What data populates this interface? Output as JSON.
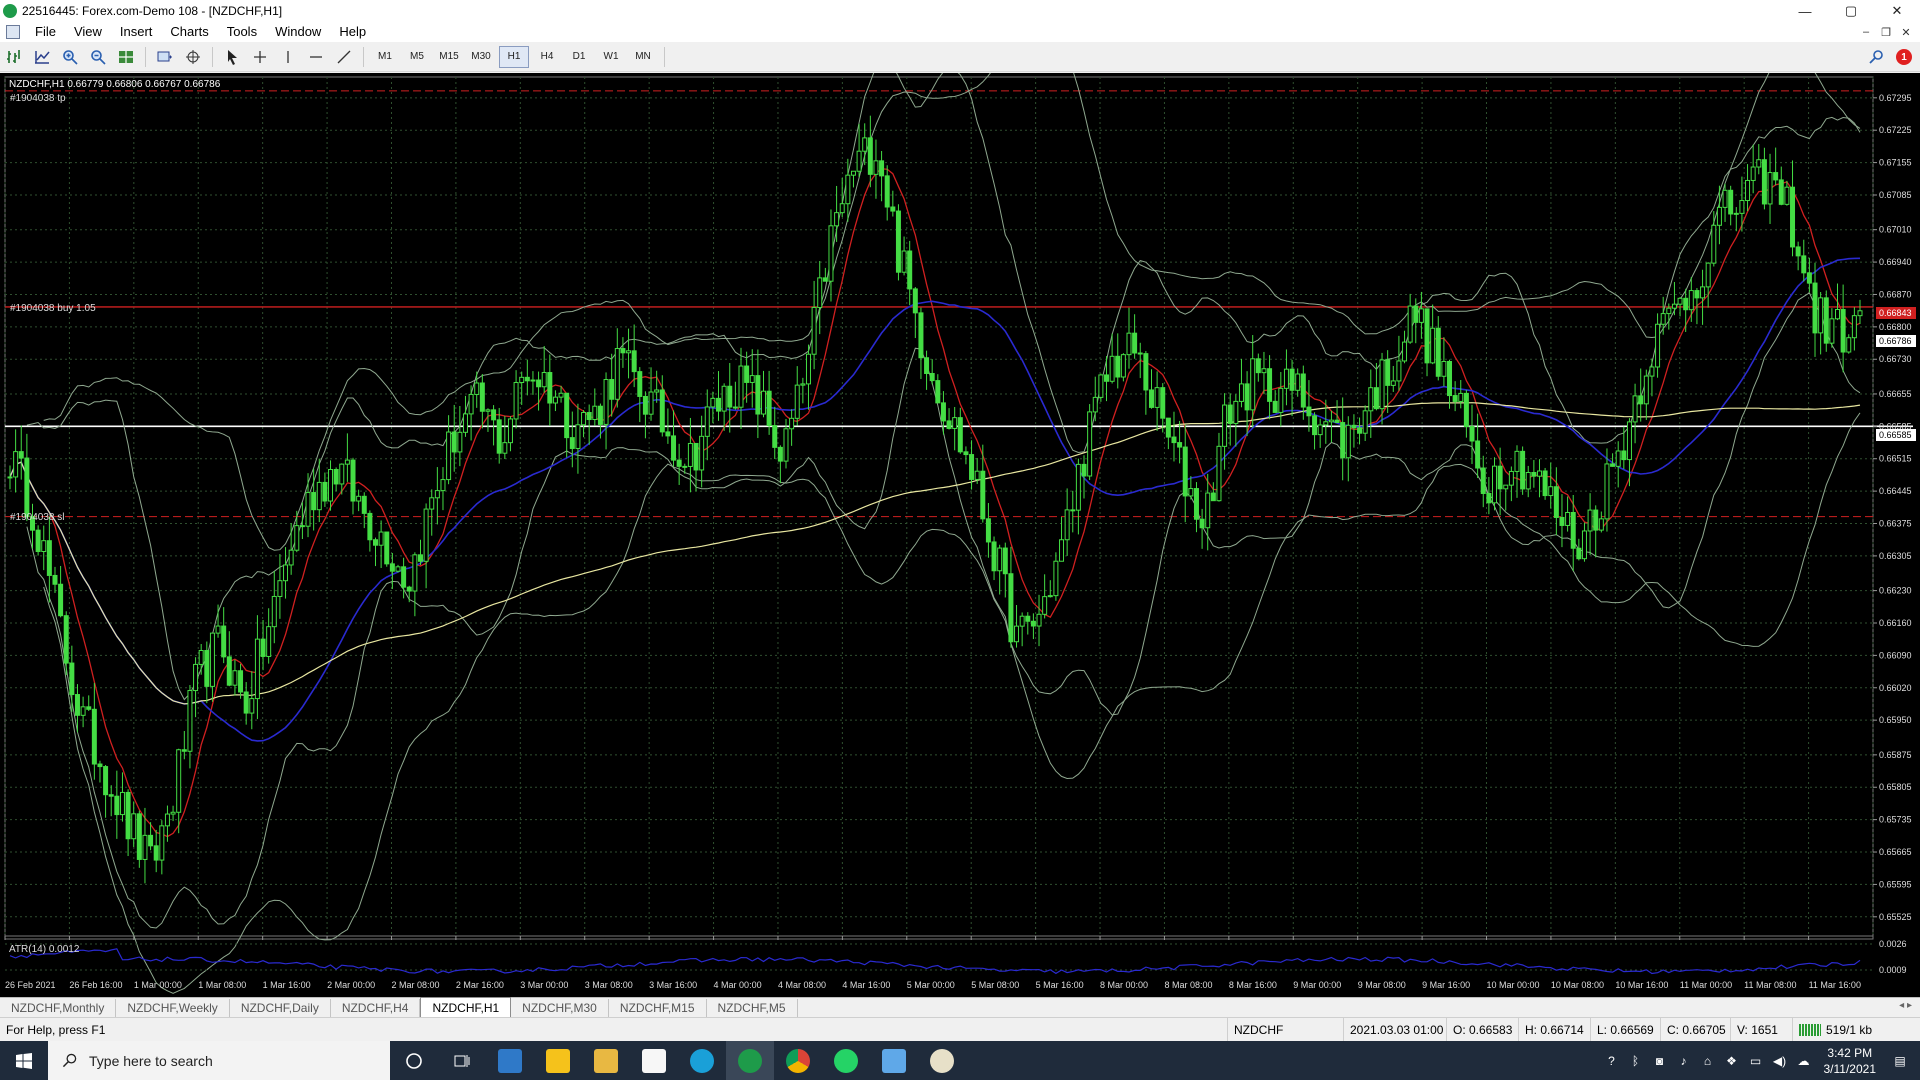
{
  "window": {
    "title": "22516445: Forex.com-Demo 108 - [NZDCHF,H1]",
    "controls": [
      "—",
      "▢",
      "✕"
    ]
  },
  "menu": [
    "File",
    "View",
    "Insert",
    "Charts",
    "Tools",
    "Window",
    "Help"
  ],
  "toolbar": {
    "timeframes": [
      "M1",
      "M5",
      "M15",
      "M30",
      "H1",
      "H4",
      "D1",
      "W1",
      "MN"
    ],
    "active_timeframe": "H1",
    "notification_count": "1"
  },
  "chart": {
    "header": "NZDCHF,H1  0.66779 0.66806 0.66767 0.66786",
    "indicator_label": "ATR(14) 0.0012",
    "tp_label": "#1904038 tp",
    "buy_label": "#1904038 buy 1.05",
    "sl_label": "#1904038 sl",
    "price_ticks": [
      "0.67295",
      "0.67225",
      "0.67155",
      "0.67085",
      "0.67010",
      "0.66940",
      "0.66870",
      "0.66800",
      "0.66730",
      "0.66655",
      "0.66585",
      "0.66515",
      "0.66445",
      "0.66375",
      "0.66305",
      "0.66230",
      "0.66160",
      "0.66090",
      "0.66020",
      "0.65950",
      "0.65875",
      "0.65805",
      "0.65735",
      "0.65665",
      "0.65595",
      "0.65525"
    ],
    "time_ticks": [
      "26 Feb 2021",
      "26 Feb 16:00",
      "1 Mar 00:00",
      "1 Mar 08:00",
      "1 Mar 16:00",
      "2 Mar 00:00",
      "2 Mar 08:00",
      "2 Mar 16:00",
      "3 Mar 00:00",
      "3 Mar 08:00",
      "3 Mar 16:00",
      "4 Mar 00:00",
      "4 Mar 08:00",
      "4 Mar 16:00",
      "5 Mar 00:00",
      "5 Mar 08:00",
      "5 Mar 16:00",
      "8 Mar 00:00",
      "8 Mar 08:00",
      "8 Mar 16:00",
      "9 Mar 00:00",
      "9 Mar 08:00",
      "9 Mar 16:00",
      "10 Mar 00:00",
      "10 Mar 08:00",
      "10 Mar 16:00",
      "11 Mar 00:00",
      "11 Mar 08:00",
      "11 Mar 16:00"
    ],
    "atr_ticks": [
      "0.0026",
      "0.0009"
    ],
    "price_tag_buy": "0.66843",
    "price_tag_bid": "0.66786",
    "price_tag_line": "0.66585",
    "colors": {
      "candle": "#44dd44",
      "background": "#000000",
      "ma_fast": "#d02020",
      "ma_mid": "#2a2ad0",
      "ma_slow": "#e8e6a0",
      "bands": "#8fa88f",
      "grid": "#2f4f2f",
      "order_line": "#d02020",
      "hline": "#ffffff"
    }
  },
  "chart_data": {
    "type": "candlestick",
    "symbol": "NZDCHF",
    "timeframe": "H1",
    "ylim": [
      0.6549,
      0.6734
    ],
    "y_ticks": [
      0.67295,
      0.67225,
      0.67155,
      0.67085,
      0.6701,
      0.6694,
      0.6687,
      0.668,
      0.6673,
      0.66655,
      0.66585,
      0.66515,
      0.66445,
      0.66375,
      0.66305,
      0.6623,
      0.6616,
      0.6609,
      0.6602,
      0.6595,
      0.65875,
      0.65805,
      0.65735,
      0.65665,
      0.65595,
      0.65525
    ],
    "horizontal_lines": {
      "tp": 0.6731,
      "buy_entry": 0.66843,
      "sl": 0.6639,
      "white_line": 0.66585
    },
    "close_path": [
      0.6652,
      0.6641,
      0.6618,
      0.6596,
      0.6585,
      0.6573,
      0.6563,
      0.6579,
      0.6604,
      0.6612,
      0.6598,
      0.6614,
      0.6633,
      0.6645,
      0.665,
      0.6641,
      0.6634,
      0.6625,
      0.6642,
      0.6657,
      0.6663,
      0.6655,
      0.6671,
      0.6668,
      0.6659,
      0.6661,
      0.6673,
      0.6666,
      0.6658,
      0.6651,
      0.6662,
      0.6668,
      0.6664,
      0.6652,
      0.667,
      0.6698,
      0.6714,
      0.672,
      0.6695,
      0.6676,
      0.6662,
      0.665,
      0.6632,
      0.6612,
      0.6618,
      0.6634,
      0.6656,
      0.6672,
      0.6675,
      0.6662,
      0.6649,
      0.6638,
      0.6662,
      0.6668,
      0.6667,
      0.6666,
      0.666,
      0.6655,
      0.6664,
      0.6672,
      0.6683,
      0.6672,
      0.666,
      0.6646,
      0.6652,
      0.6649,
      0.664,
      0.6633,
      0.6644,
      0.6657,
      0.6675,
      0.6683,
      0.669,
      0.6703,
      0.6708,
      0.6712,
      0.6705,
      0.6683,
      0.6679,
      0.668
    ],
    "atr_value": 0.0012,
    "atr_ylim": [
      0.0007,
      0.0028
    ]
  }
}
